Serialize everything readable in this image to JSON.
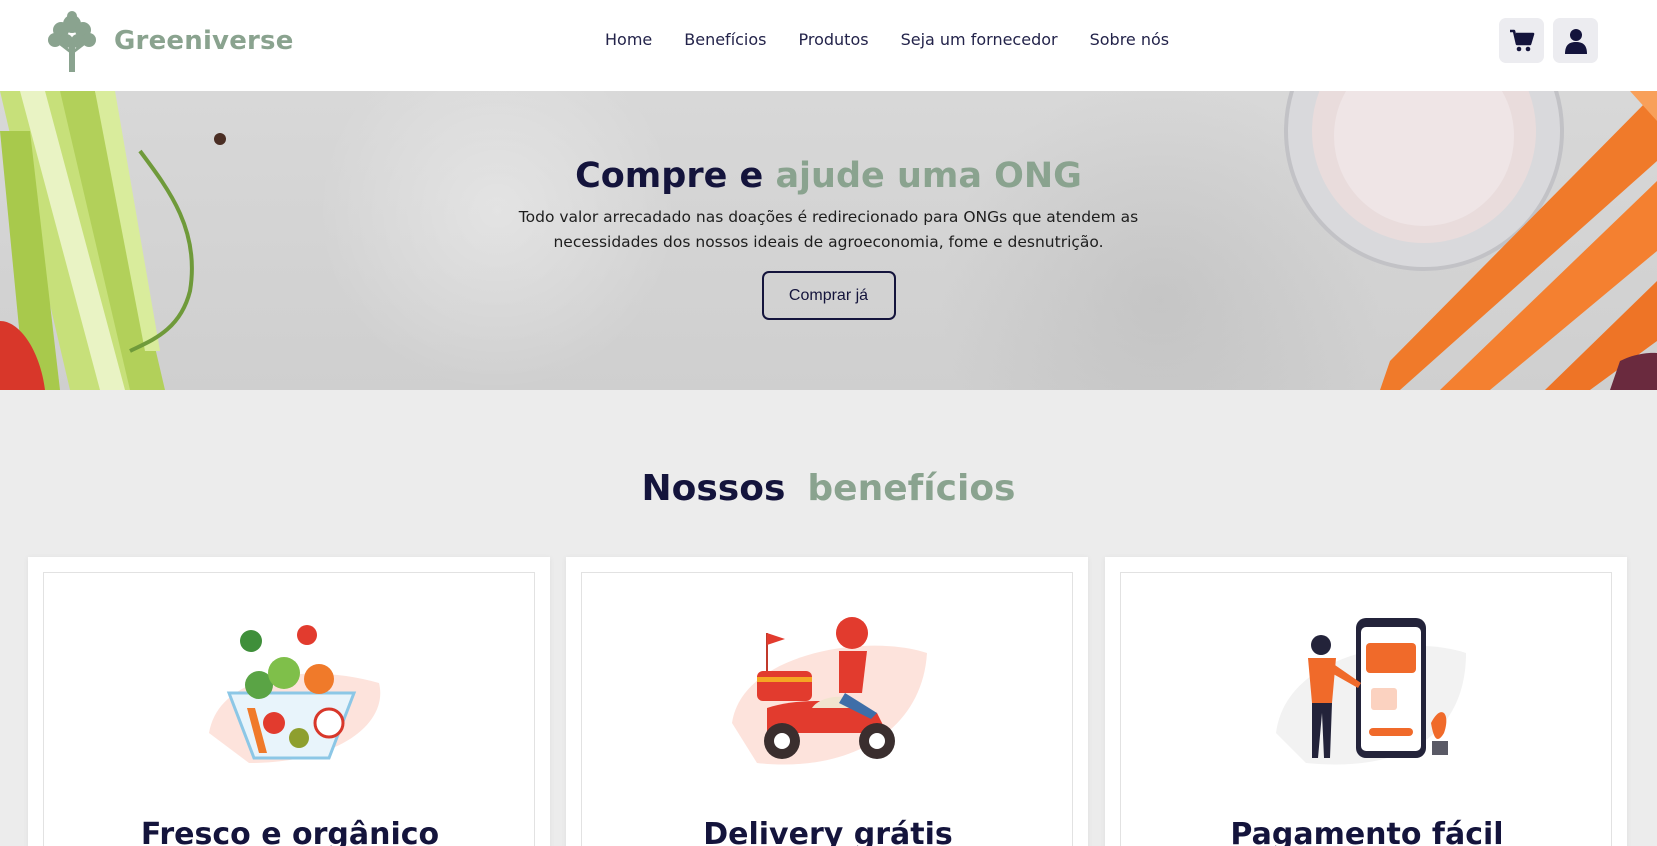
{
  "header": {
    "brand_name": "Greeniverse",
    "logo_icon": "tree-icon",
    "nav": [
      "Home",
      "Benefícios",
      "Produtos",
      "Seja um fornecedor",
      "Sobre nós"
    ],
    "cart_icon": "cart-icon",
    "user_icon": "user-icon"
  },
  "hero": {
    "title_part1": "Compre e",
    "title_part2": "ajude uma ONG",
    "text": "Todo valor arrecadado nas doações é redirecionado para ONGs que atendem as necessidades dos nossos ideais de agroeconomia, fome e desnutrição.",
    "button_label": "Comprar já"
  },
  "benefits": {
    "title_part1": "Nossos",
    "title_part2": "benefícios",
    "cards": [
      {
        "title": "Fresco e orgânico",
        "illustration": "vegetable-bowl-illustration"
      },
      {
        "title": "Delivery grátis",
        "illustration": "scooter-delivery-illustration"
      },
      {
        "title": "Pagamento fácil",
        "illustration": "mobile-payment-illustration"
      }
    ]
  },
  "colors": {
    "brand_green": "#8aa38f",
    "navy": "#14143c",
    "background": "#ececec",
    "accent_orange": "#f06a2a"
  }
}
